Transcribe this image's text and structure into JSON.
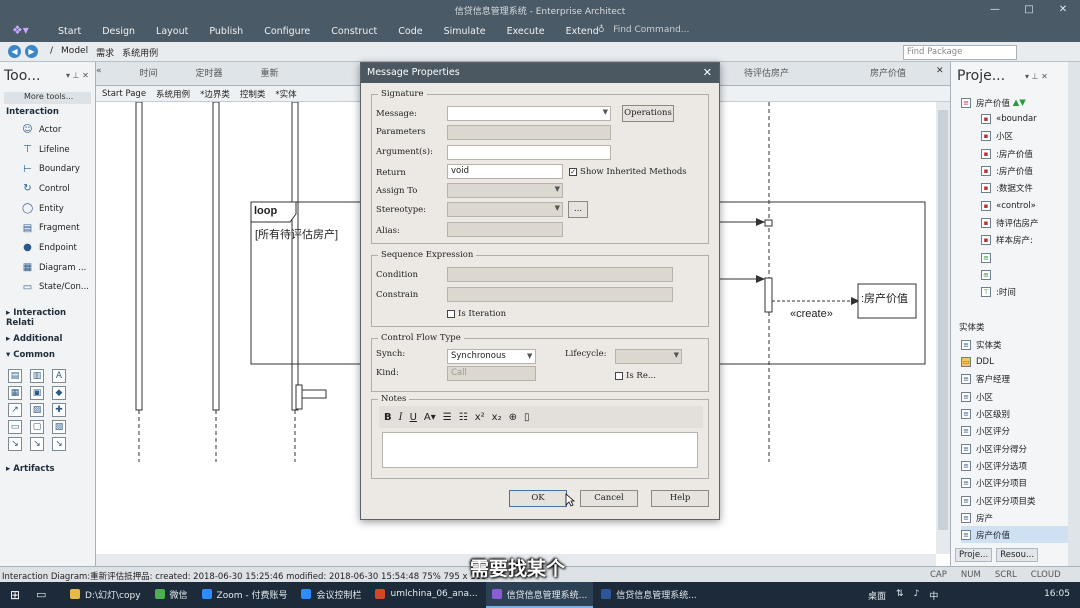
{
  "window": {
    "title": "信贷信息管理系统 - Enterprise Architect",
    "controls": [
      "—",
      "□",
      "✕"
    ]
  },
  "menu": {
    "logo_icon": "ea-logo-icon",
    "items": [
      "Start",
      "Design",
      "Layout",
      "Publish",
      "Configure",
      "Construct",
      "Code",
      "Simulate",
      "Execute",
      "Extend"
    ],
    "find_command": "Find Command..."
  },
  "navbar": {
    "breadcrumbs": [
      "/",
      "Model",
      "需求",
      "系统用例"
    ],
    "find_package_placeholder": "Find Package"
  },
  "toolbox": {
    "title": "Too...",
    "more_tools": "More tools...",
    "sections": {
      "interaction": "Interaction",
      "interaction_relations": "Interaction Relati",
      "additional": "Additional",
      "common": "Common",
      "artifacts": "Artifacts"
    },
    "tools": [
      {
        "label": "Actor",
        "icon": "actor-icon"
      },
      {
        "label": "Lifeline",
        "icon": "lifeline-icon"
      },
      {
        "label": "Boundary",
        "icon": "boundary-icon"
      },
      {
        "label": "Control",
        "icon": "control-icon"
      },
      {
        "label": "Entity",
        "icon": "entity-icon"
      },
      {
        "label": "Fragment",
        "icon": "fragment-icon"
      },
      {
        "label": "Endpoint",
        "icon": "endpoint-icon"
      },
      {
        "label": "Diagram ...",
        "icon": "diagram-icon"
      },
      {
        "label": "State/Con...",
        "icon": "state-icon"
      }
    ]
  },
  "diagram": {
    "tabs": [
      "时间",
      "定时器",
      "重新",
      "待评估房产",
      "房产价值"
    ],
    "toolbar": [
      "Start Page",
      "系统用例",
      "*边界类",
      "控制类",
      "*实体"
    ],
    "loop_label": "loop",
    "loop_condition": "[所有待评估房产]",
    "create_label": "«create»",
    "object_label": ":房产价值"
  },
  "dialog": {
    "title": "Message Properties",
    "groups": {
      "signature": "Signature",
      "sequence": "Sequence Expression",
      "control_flow": "Control Flow Type",
      "notes": "Notes"
    },
    "labels": {
      "message": "Message:",
      "parameters": "Parameters",
      "arguments": "Argument(s):",
      "return": "Return",
      "assign_to": "Assign To",
      "stereotype": "Stereotype:",
      "alias": "Alias:",
      "condition": "Condition",
      "constrain": "Constrain",
      "synch": "Synch:",
      "kind": "Kind:",
      "lifecycle": "Lifecycle:"
    },
    "values": {
      "return": "void",
      "synch": "Synchronous",
      "kind": "Call"
    },
    "checks": {
      "show_inherited": "Show Inherited Methods",
      "is_iteration": "Is Iteration",
      "is_return": "Is Re..."
    },
    "buttons": {
      "operations": "Operations",
      "ellipsis": "...",
      "ok": "OK",
      "cancel": "Cancel",
      "help": "Help"
    }
  },
  "project": {
    "title": "Proje...",
    "root": "房产价值",
    "items": [
      "«boundar",
      "小区",
      ":房产价值",
      ":房产价值",
      ":数据文件",
      "«control»",
      "待评估房产",
      "样本房产: ",
      "",
      "",
      ":时间"
    ],
    "entity_section": "实体类",
    "entities": [
      "实体类",
      "DDL",
      "客户经理",
      "小区",
      "小区级别",
      "小区评分",
      "小区评分得分",
      "小区评分选项",
      "小区评分项目",
      "小区评分项目类",
      "房产",
      "房产价值"
    ],
    "tabs": [
      "Proje...",
      "Resou..."
    ]
  },
  "status": {
    "text": "Interaction Diagram:重新评估抵押品:  created: 2018-06-30 15:25:46  modified: 2018-06-30 15:54:48   75%   795 x 113",
    "indicators": [
      "CAP",
      "NUM",
      "SCRL",
      "CLOUD"
    ]
  },
  "subtitle": "需要找某个",
  "taskbar": {
    "apps": [
      {
        "label": "D:\\幻灯\\copy",
        "color": "#e8b84a"
      },
      {
        "label": "微信",
        "color": "#4caf50"
      },
      {
        "label": "Zoom - 付费账号",
        "color": "#2d8cff"
      },
      {
        "label": "会议控制栏",
        "color": "#2d8cff"
      },
      {
        "label": "umlchina_06_ana...",
        "color": "#d24726"
      },
      {
        "label": "信贷信息管理系统...",
        "color": "#8a5cd6"
      },
      {
        "label": "信贷信息管理系统...",
        "color": "#2b579a"
      }
    ],
    "tray": [
      "桌面",
      "中"
    ],
    "clock": "16:05"
  }
}
